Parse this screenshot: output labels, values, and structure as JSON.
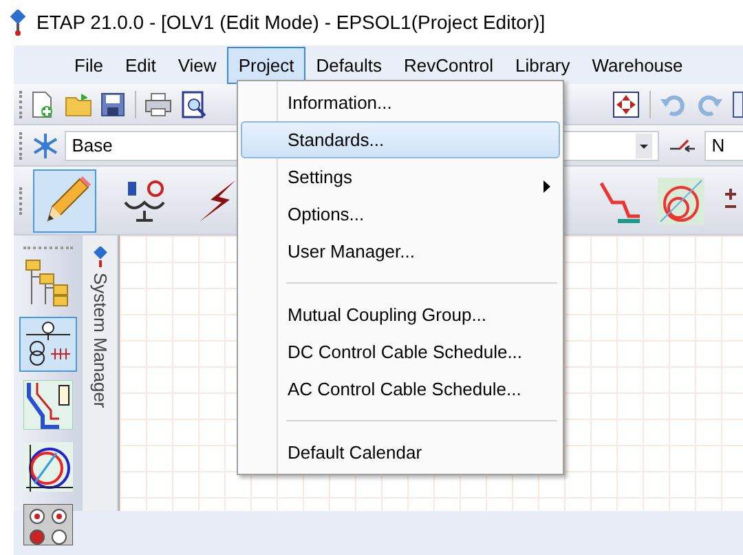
{
  "window": {
    "title": "ETAP 21.0.0 - [OLV1 (Edit Mode) - EPSOL1(Project Editor)]"
  },
  "menu_bar": [
    {
      "label": "File",
      "selected": false
    },
    {
      "label": "Edit",
      "selected": false
    },
    {
      "label": "View",
      "selected": false
    },
    {
      "label": "Project",
      "selected": true
    },
    {
      "label": "Defaults",
      "selected": false
    },
    {
      "label": "RevControl",
      "selected": false
    },
    {
      "label": "Library",
      "selected": false
    },
    {
      "label": "Warehouse",
      "selected": false
    }
  ],
  "presentation_combo": {
    "value": "Base"
  },
  "config_combo": {
    "value": "N"
  },
  "mode_tools": [
    {
      "selected": true
    },
    {
      "selected": false
    },
    {
      "selected": false
    }
  ],
  "view_tools": [
    {
      "selected": false
    },
    {
      "selected": true
    },
    {
      "selected": false
    },
    {
      "selected": false
    },
    {
      "selected": false
    }
  ],
  "side_tab": {
    "label": "System Manager"
  },
  "project_menu": {
    "items": [
      {
        "kind": "item",
        "label": "Information...",
        "selected": false
      },
      {
        "kind": "item",
        "label": "Standards...",
        "selected": true
      },
      {
        "kind": "submenu",
        "label": "Settings",
        "selected": false
      },
      {
        "kind": "item",
        "label": "Options...",
        "selected": false
      },
      {
        "kind": "item",
        "label": "User Manager...",
        "selected": false
      },
      {
        "kind": "separator"
      },
      {
        "kind": "item",
        "label": "Mutual Coupling Group...",
        "selected": false
      },
      {
        "kind": "item",
        "label": "DC Control Cable Schedule...",
        "selected": false
      },
      {
        "kind": "item",
        "label": "AC Control Cable Schedule...",
        "selected": false
      },
      {
        "kind": "separator"
      },
      {
        "kind": "item",
        "label": "Default Calendar",
        "selected": false
      }
    ]
  }
}
